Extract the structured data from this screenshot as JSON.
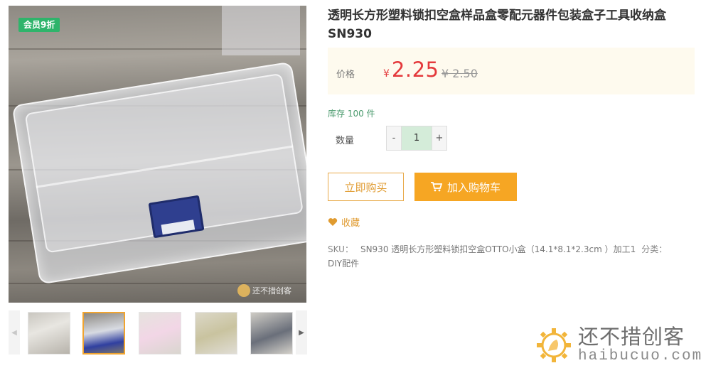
{
  "product": {
    "title": "透明长方形塑料锁扣空盒样品盒零配元器件包装盒子工具收纳盒SN930",
    "member_badge": "会员9折",
    "image_watermark": "还不措创客"
  },
  "price": {
    "label": "价格",
    "currency_symbol": "¥",
    "current": "2.25",
    "original": "¥ 2.50"
  },
  "stock": {
    "text": "库存 100 件"
  },
  "quantity": {
    "label": "数量",
    "minus": "-",
    "value": "1",
    "plus": "+"
  },
  "actions": {
    "buy_now": "立即购买",
    "add_to_cart": "加入购物车",
    "favorite": "收藏"
  },
  "meta": {
    "sku_label": "SKU：",
    "sku_value": "SN930 透明长方形塑料锁扣空盒OTTO小盒（14.1*8.1*2.3cm ）加工1",
    "category_label": "分类：",
    "category_value": "DIY配件"
  },
  "thumbnails": {
    "items": [
      "thumb-1",
      "thumb-2",
      "thumb-3",
      "thumb-4",
      "thumb-5"
    ],
    "active_index": 1
  },
  "brand_watermark": {
    "cn": "还不措创客",
    "en": "haibucuo.com"
  },
  "colors": {
    "price_red": "#e4393c",
    "accent_orange": "#f6a623",
    "badge_green": "#2fb46b",
    "price_bg": "#fefaee"
  },
  "icons": {
    "cart": "cart-icon",
    "favorite": "heart-icon",
    "brand": "gear-logo-icon"
  }
}
